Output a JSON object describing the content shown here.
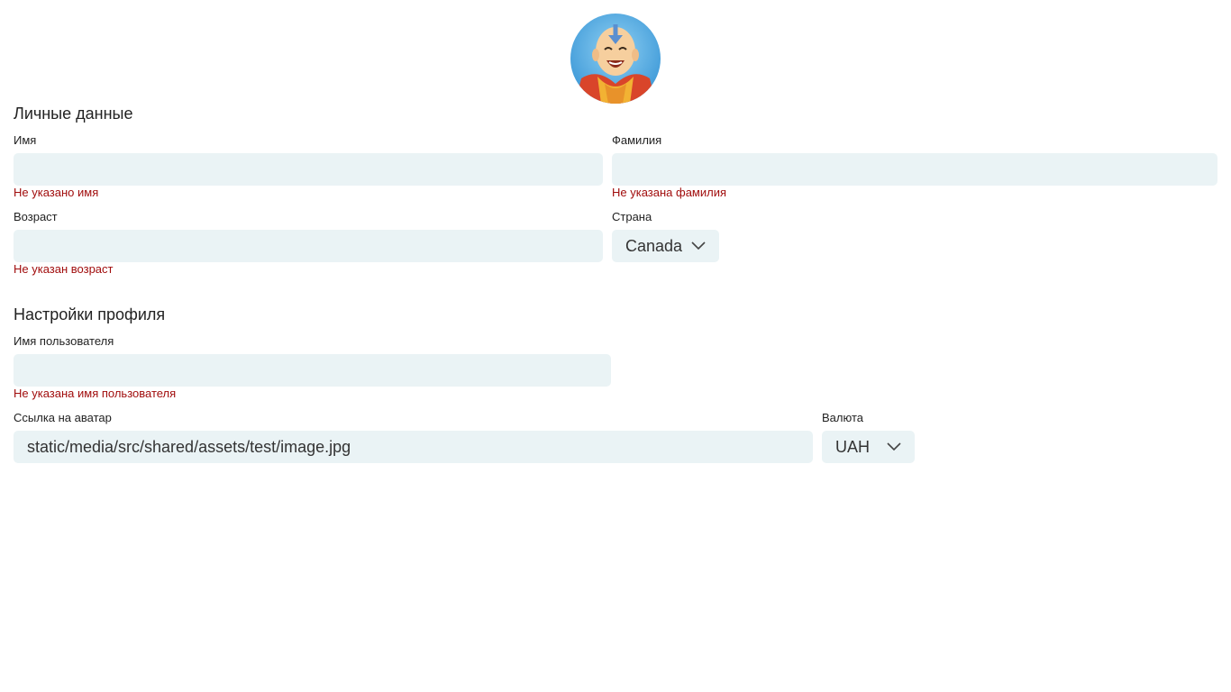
{
  "avatar": {
    "icon": "avatar-icon"
  },
  "personal": {
    "title": "Личные данные",
    "first_name": {
      "label": "Имя",
      "value": "",
      "error": "Не указано имя"
    },
    "last_name": {
      "label": "Фамилия",
      "value": "",
      "error": "Не указана фамилия"
    },
    "age": {
      "label": "Возраст",
      "value": "",
      "error": "Не указан возраст"
    },
    "country": {
      "label": "Страна",
      "selected": "Canada"
    }
  },
  "profile": {
    "title": "Настройки профиля",
    "username": {
      "label": "Имя пользователя",
      "value": "",
      "error": "Не указана имя пользователя"
    },
    "avatar_link": {
      "label": "Ссылка на аватар",
      "value": "static/media/src/shared/assets/test/image.jpg"
    },
    "currency": {
      "label": "Валюта",
      "selected": "UAH"
    }
  },
  "colors": {
    "input_bg": "#eaf3f5",
    "error": "#a10d0d",
    "text": "#222222"
  }
}
